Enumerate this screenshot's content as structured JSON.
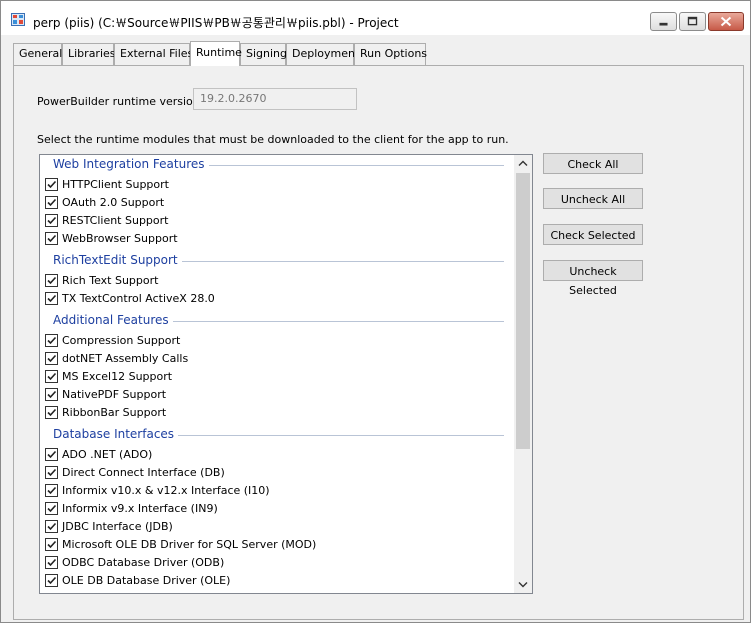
{
  "window": {
    "title": "perp (piis) (C:￦Source￦PIIS￦PB￦공통관리￦piis.pbl) - Project"
  },
  "tabs": [
    {
      "label": "General"
    },
    {
      "label": "Libraries"
    },
    {
      "label": "External Files"
    },
    {
      "label": "Runtime"
    },
    {
      "label": "Signing"
    },
    {
      "label": "Deployment"
    },
    {
      "label": "Run Options"
    }
  ],
  "active_tab": "Runtime",
  "runtime": {
    "version_label": "PowerBuilder runtime version:",
    "version_value": "19.2.0.2670",
    "instructions": "Select the runtime modules that must be downloaded to the client for the app to run."
  },
  "groups": [
    {
      "title": "Web Integration Features",
      "items": [
        {
          "label": "HTTPClient Support",
          "checked": true
        },
        {
          "label": "OAuth 2.0 Support",
          "checked": true
        },
        {
          "label": "RESTClient Support",
          "checked": true
        },
        {
          "label": "WebBrowser Support",
          "checked": true
        }
      ]
    },
    {
      "title": "RichTextEdit Support",
      "items": [
        {
          "label": "Rich Text Support",
          "checked": true
        },
        {
          "label": "TX TextControl ActiveX 28.0",
          "checked": true
        }
      ]
    },
    {
      "title": "Additional Features",
      "items": [
        {
          "label": "Compression Support",
          "checked": true
        },
        {
          "label": "dotNET Assembly Calls",
          "checked": true
        },
        {
          "label": "MS Excel12 Support",
          "checked": true
        },
        {
          "label": "NativePDF Support",
          "checked": true
        },
        {
          "label": "RibbonBar Support",
          "checked": true
        }
      ]
    },
    {
      "title": "Database Interfaces",
      "items": [
        {
          "label": "ADO .NET (ADO)",
          "checked": true
        },
        {
          "label": "Direct Connect Interface (DB)",
          "checked": true
        },
        {
          "label": "Informix v10.x & v12.x Interface (I10)",
          "checked": true
        },
        {
          "label": "Informix v9.x Interface (IN9)",
          "checked": true
        },
        {
          "label": "JDBC Interface (JDB)",
          "checked": true
        },
        {
          "label": "Microsoft OLE DB Driver for SQL Server (MOD)",
          "checked": true
        },
        {
          "label": "ODBC Database Driver (ODB)",
          "checked": true
        },
        {
          "label": "OLE DB Database Driver (OLE)",
          "checked": true
        }
      ]
    }
  ],
  "buttons": {
    "check_all": "Check All",
    "uncheck_all": "Uncheck All",
    "check_selected": "Check Selected",
    "uncheck_selected": "Uncheck Selected"
  },
  "icons": {
    "app": "project-icon",
    "checkbox": "checkmark-icon",
    "scroll_up": "chevron-up-icon",
    "scroll_down": "chevron-down-icon"
  },
  "colors": {
    "group_header": "#1d3fa0",
    "active_tab_bg": "#ffffff",
    "button_bg": "#e1e1e1"
  }
}
